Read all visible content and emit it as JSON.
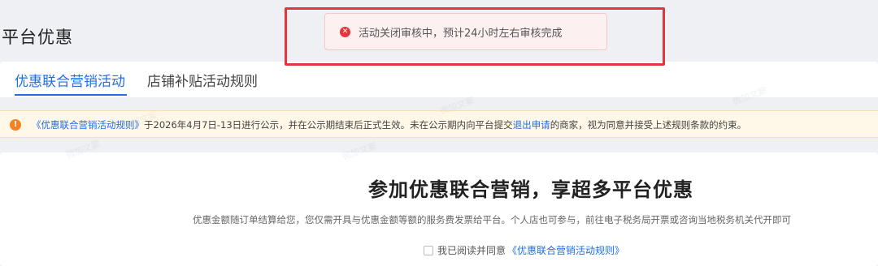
{
  "page": {
    "title": "平台优惠"
  },
  "tabs": [
    {
      "label": "优惠联合营销活动",
      "active": true
    },
    {
      "label": "店铺补贴活动规则",
      "active": false
    }
  ],
  "notice": {
    "icon": "warning-icon",
    "link1": "《优惠联合营销活动规则》",
    "text1": "于2026年4月7日-13日进行公示，并在公示期结束后正式生效。未在公示期内向平台提交",
    "link2": "退出申请",
    "text2": "的商家，视为同意并接受上述规则条款的约束。"
  },
  "main": {
    "title": "参加优惠联合营销，享超多平台优惠",
    "description": "优惠金额随订单结算给您，您仅需开具与优惠金额等额的服务费发票给平台。个人店也可参与，前往电子税务局开票或咨询当地税务机关代开即可",
    "agree_text": "我已阅读并同意",
    "agree_link": "《优惠联合营销活动规则》"
  },
  "toast": {
    "icon": "error-icon",
    "message": "活动关闭审核中，预计24小时左右审核完成"
  },
  "watermark": {
    "text": "微加文案"
  },
  "colors": {
    "accent": "#1e6fe8",
    "error": "#e0383e",
    "warning": "#f58220",
    "highlight_frame": "#e3363a"
  }
}
